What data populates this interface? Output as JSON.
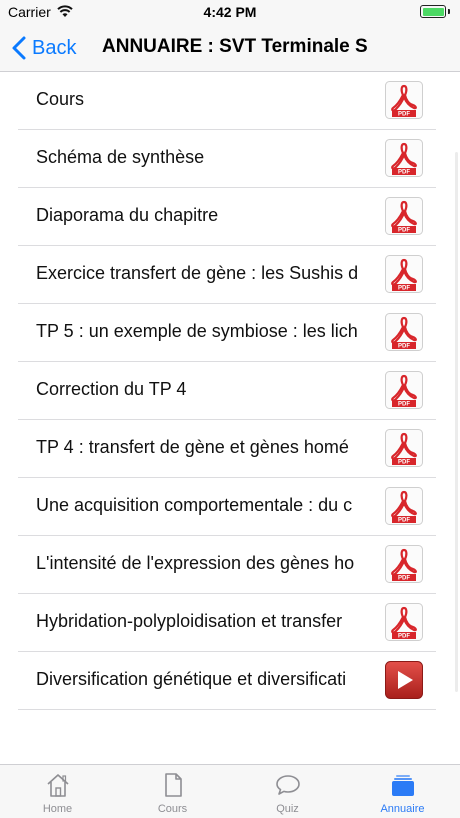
{
  "status_bar": {
    "carrier": "Carrier",
    "time": "4:42 PM"
  },
  "nav": {
    "back_label": "Back",
    "title": "ANNUAIRE : SVT Terminale S"
  },
  "colors": {
    "accent": "#0a7aff",
    "tab_active": "#2b7bf6",
    "pdf_red": "#d8262b",
    "video_red": "#c9302c"
  },
  "items": [
    {
      "label": "Cours",
      "icon": "pdf-icon"
    },
    {
      "label": "Schéma de synthèse",
      "icon": "pdf-icon"
    },
    {
      "label": "Diaporama du chapitre",
      "icon": "pdf-icon"
    },
    {
      "label": "Exercice transfert de gène : les Sushis d",
      "icon": "pdf-icon"
    },
    {
      "label": "TP 5 : un exemple de symbiose : les lich",
      "icon": "pdf-icon"
    },
    {
      "label": "Correction du TP 4",
      "icon": "pdf-icon"
    },
    {
      "label": "TP 4 : transfert de gène et gènes homé",
      "icon": "pdf-icon"
    },
    {
      "label": "Une acquisition comportementale : du c",
      "icon": "pdf-icon"
    },
    {
      "label": "L'intensité de l'expression des gènes ho",
      "icon": "pdf-icon"
    },
    {
      "label": "Hybridation-polyploidisation et transfer",
      "icon": "pdf-icon"
    },
    {
      "label": "Diversification génétique et diversificati",
      "icon": "video-icon"
    }
  ],
  "pdf_badge": "PDF",
  "tabs": [
    {
      "label": "Home",
      "icon": "house-icon"
    },
    {
      "label": "Cours",
      "icon": "document-icon"
    },
    {
      "label": "Quiz",
      "icon": "speech-bubble-icon"
    },
    {
      "label": "Annuaire",
      "icon": "folder-stack-icon",
      "active": true
    }
  ]
}
